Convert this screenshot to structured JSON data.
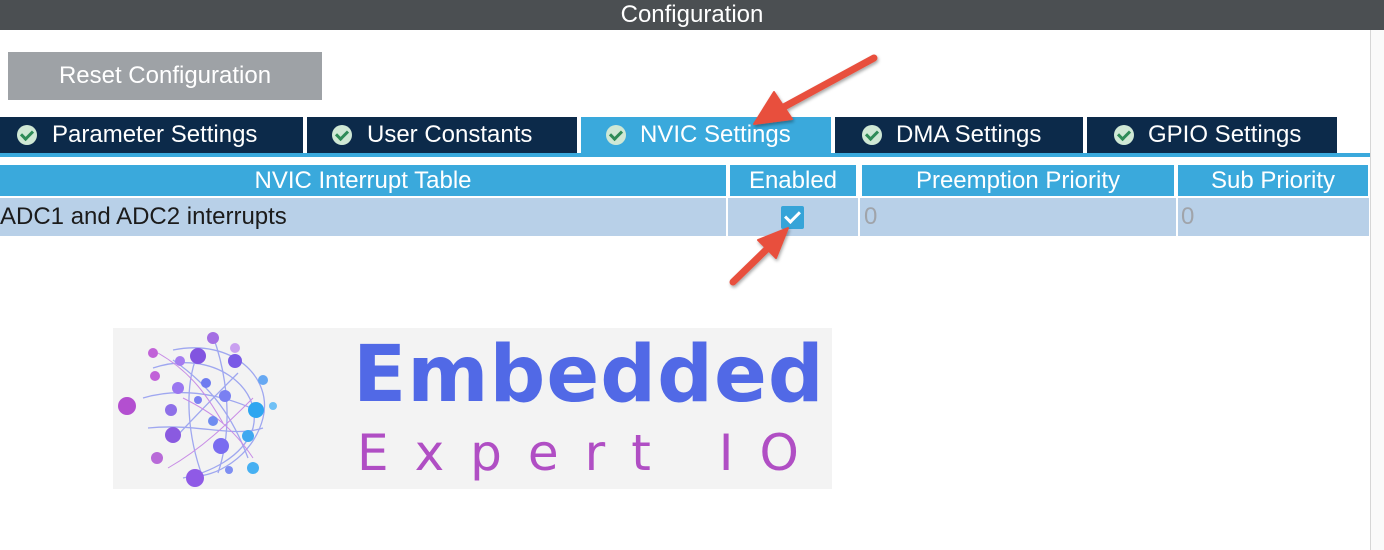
{
  "window": {
    "title": "Configuration"
  },
  "toolbar": {
    "reset_label": "Reset Configuration"
  },
  "tabs": [
    {
      "label": "Parameter Settings",
      "active": false
    },
    {
      "label": "User Constants",
      "active": false
    },
    {
      "label": "NVIC Settings",
      "active": true
    },
    {
      "label": "DMA Settings",
      "active": false
    },
    {
      "label": "GPIO Settings",
      "active": false
    }
  ],
  "table": {
    "headers": [
      "NVIC Interrupt Table",
      "Enabled",
      "Preemption Priority",
      "Sub Priority"
    ],
    "rows": [
      {
        "name": "ADC1 and ADC2 interrupts",
        "enabled": true,
        "preemption": "0",
        "sub": "0"
      }
    ]
  },
  "logo": {
    "line1": "Embedded",
    "line2": "Expert IO"
  },
  "colors": {
    "accent": "#3aa9dc",
    "tab_bg": "#0c2a4a",
    "titlebar": "#4b4f52",
    "arrow": "#e8503e"
  }
}
